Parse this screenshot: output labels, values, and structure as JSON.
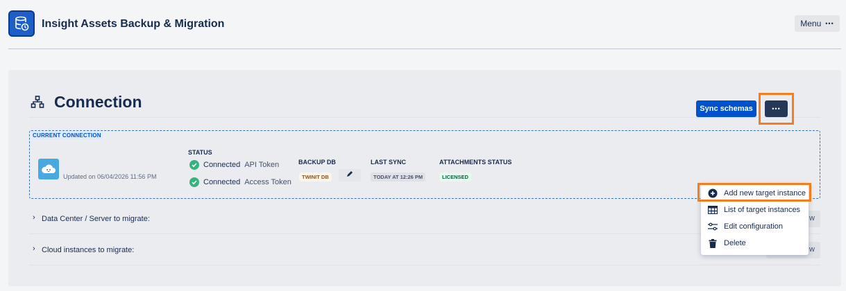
{
  "app": {
    "title": "Insight Assets Backup & Migration",
    "menu_label": "Menu",
    "menu_dots": "•••"
  },
  "connection": {
    "title": "Connection",
    "current_label": "CURRENT CONNECTION",
    "updated_text": "Updated on 06/04/2026 11:56 PM",
    "status": {
      "header": "STATUS",
      "rows": [
        {
          "state": "Connected",
          "type": "API Token"
        },
        {
          "state": "Connected",
          "type": "Access Token"
        }
      ]
    },
    "backup_db": {
      "header": "BACKUP DB",
      "value": "TWINIT DB"
    },
    "last_sync": {
      "header": "LAST SYNC",
      "value": "TODAY AT 12:26 PM"
    },
    "attachments": {
      "header": "ATTACHMENTS STATUS",
      "value": "LICENSED"
    },
    "sync_button": "Sync schemas",
    "more_button": "•••"
  },
  "sections": [
    {
      "label": "Data Center / Server to migrate:",
      "button_fragment": "w"
    },
    {
      "label": "Cloud instances to migrate:",
      "button_fragment": "w"
    }
  ],
  "dropdown": {
    "items": [
      {
        "label": "Add new target instance",
        "icon": "plus-circle-icon"
      },
      {
        "label": "List of target instances",
        "icon": "table-icon"
      },
      {
        "label": "Edit configuration",
        "icon": "sliders-icon"
      },
      {
        "label": "Delete",
        "icon": "trash-icon"
      }
    ]
  },
  "colors": {
    "primary": "#0052cc",
    "highlight": "#f57c1f",
    "success": "#36b37e",
    "dark_button": "#253858"
  }
}
